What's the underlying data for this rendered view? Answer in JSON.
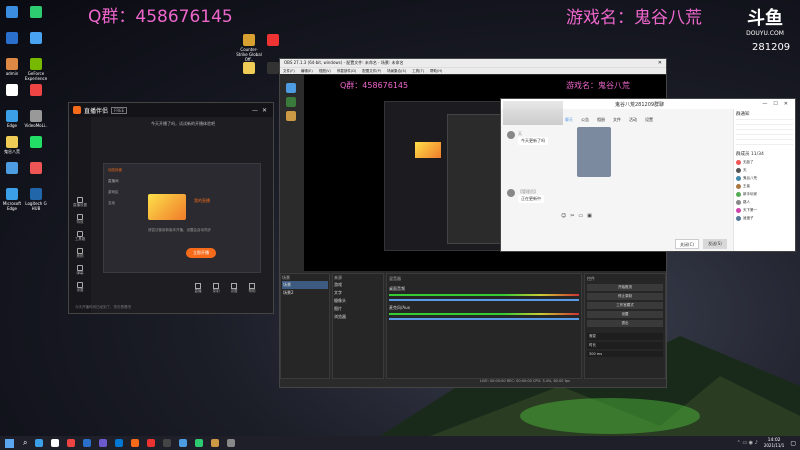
{
  "overlay": {
    "qq_group": "Q群：458676145",
    "game_name": "游戏名：鬼谷八荒",
    "platform_logo": "斗鱼",
    "platform_url": "DOUYU.COM",
    "room_id": "281209"
  },
  "desktop": {
    "icons_left": [
      "",
      "",
      "",
      "",
      "admin",
      "GeForce Experience",
      "",
      "",
      "Edge",
      "VideoMoLi..",
      "鬼谷八荒",
      "",
      "",
      "",
      "Microsoft Edge",
      "Logitech G HUB"
    ],
    "icons_mid": [
      "Counter-Strike Global Off..",
      "",
      "",
      ""
    ]
  },
  "live_companion": {
    "title": "直播伴侣",
    "badge": "FREE",
    "sidebar": [
      "直播设置",
      "特效",
      "工具箱",
      "美颜",
      "弹幕",
      "设置"
    ],
    "notice": "今天开播了吗，试试新的开播体验吧",
    "popup_items": [
      "动态封面",
      "直播间",
      "游戏区",
      "互动"
    ],
    "popup_link": "我的直播",
    "popup_hint": "请尝试使用新版本开播，设置会自动同步",
    "popup_button": "立即开播",
    "bottom_labels": [
      "直播",
      "录制",
      "设置",
      "帮助"
    ],
    "footer": "今天开播时间已经到了，快去看看吧"
  },
  "obs": {
    "title": "OBS 27.1.3 (64-bit, windows) - 配置文件: 未命名 - 场景: 未命名",
    "menu": [
      "文件(F)",
      "编辑(E)",
      "视图(V)",
      "停靠部件(D)",
      "配置文件(P)",
      "场景集合(S)",
      "工具(T)",
      "帮助(H)"
    ],
    "preview_qq": "Q群：458676145",
    "preview_game": "游戏名：鬼谷八荒",
    "docks": [
      "场景",
      "来源",
      "混音器",
      "场景过渡",
      "控件"
    ],
    "scenes": [
      "场景",
      "场景2"
    ],
    "sources": [
      "游戏",
      "文字",
      "摄像头",
      "图片",
      "浏览器"
    ],
    "mixer": [
      "桌面音频",
      "麦克风/Aux"
    ],
    "controls": [
      "开始推流",
      "停止录制",
      "工作室模式",
      "设置",
      "退出"
    ],
    "transition": [
      "渐变",
      "时长",
      "300 ms"
    ],
    "status": "LIVE: 00:00:00  REC: 00:00:00  CPU: 3.4%, 60.00 fps"
  },
  "chat": {
    "title": "鬼谷八荒281209群聊",
    "tabs": [
      "聊天",
      "公告",
      "相册",
      "文件",
      "活动",
      "设置"
    ],
    "messages": [
      {
        "user": "天",
        "text": "今天更新了吗"
      },
      {
        "user": "【管理员】",
        "text": "正在更新中"
      }
    ],
    "right_title": "群通知",
    "members_label": "群成员 11/34",
    "members": [
      "无敌了",
      "天",
      "鬼谷八荒",
      "王者",
      "新手玩家",
      "路人",
      "天下第一",
      "逍遥子"
    ],
    "close_btn": "关闭(C)",
    "send_btn": "发送(S)"
  },
  "taskbar": {
    "weather": "",
    "time": "14:02",
    "date": "2021/11/1"
  },
  "colors": {
    "pink": "#e6c",
    "obs_bg": "#2b2b2b",
    "companion_bg": "#1d1d22",
    "accent_orange": "#f66b1a",
    "chat_accent": "#5a9be8"
  }
}
